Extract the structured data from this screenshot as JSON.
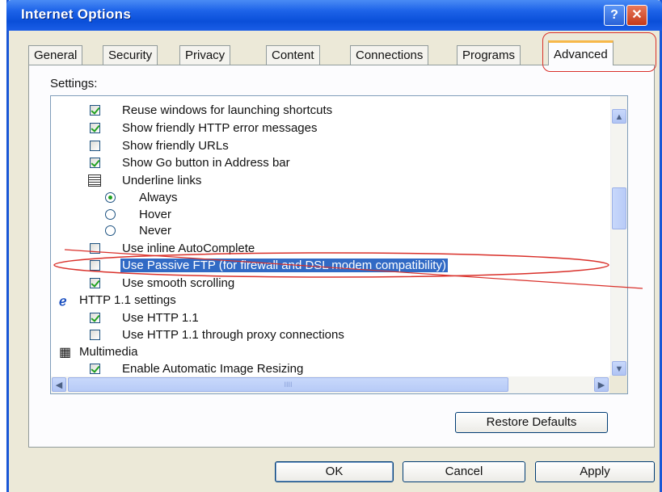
{
  "window": {
    "title": "Internet Options"
  },
  "titlebar_buttons": {
    "help": "?",
    "close": "✕"
  },
  "tabs": [
    {
      "label": "General"
    },
    {
      "label": "Security"
    },
    {
      "label": "Privacy"
    },
    {
      "label": "Content"
    },
    {
      "label": "Connections"
    },
    {
      "label": "Programs"
    },
    {
      "label": "Advanced",
      "active": true
    }
  ],
  "settings_label": "Settings:",
  "settings": [
    {
      "type": "checkbox",
      "checked": true,
      "label": "Reuse windows for launching shortcuts"
    },
    {
      "type": "checkbox",
      "checked": true,
      "label": "Show friendly HTTP error messages"
    },
    {
      "type": "checkbox",
      "checked": false,
      "label": "Show friendly URLs"
    },
    {
      "type": "checkbox",
      "checked": true,
      "label": "Show Go button in Address bar"
    },
    {
      "type": "group",
      "icon": "list-icon",
      "label": "Underline links"
    },
    {
      "type": "radio",
      "checked": true,
      "label": "Always"
    },
    {
      "type": "radio",
      "checked": false,
      "label": "Hover"
    },
    {
      "type": "radio",
      "checked": false,
      "label": "Never"
    },
    {
      "type": "checkbox",
      "checked": false,
      "label": "Use inline AutoComplete"
    },
    {
      "type": "checkbox",
      "checked": false,
      "selected": true,
      "label": "Use Passive FTP (for firewall and DSL modem compatibility)"
    },
    {
      "type": "checkbox",
      "checked": true,
      "label": "Use smooth scrolling"
    },
    {
      "type": "group",
      "icon": "ie-icon",
      "label": "HTTP 1.1 settings"
    },
    {
      "type": "checkbox",
      "checked": true,
      "label": "Use HTTP 1.1"
    },
    {
      "type": "checkbox",
      "checked": false,
      "label": "Use HTTP 1.1 through proxy connections"
    },
    {
      "type": "group",
      "icon": "multimedia-icon",
      "label": "Multimedia"
    },
    {
      "type": "checkbox",
      "checked": true,
      "label": "Enable Automatic Image Resizing"
    }
  ],
  "scroll_glyphs": {
    "up": "▲",
    "down": "▼",
    "left": "◀",
    "right": "▶",
    "grip": "IIII"
  },
  "buttons": {
    "restore_defaults": "Restore Defaults",
    "ok": "OK",
    "cancel": "Cancel",
    "apply": "Apply"
  },
  "colors": {
    "titlebar": "#0a4fd9",
    "selection": "#316ac5",
    "annotation": "#d9302a",
    "check": "#21a121"
  }
}
